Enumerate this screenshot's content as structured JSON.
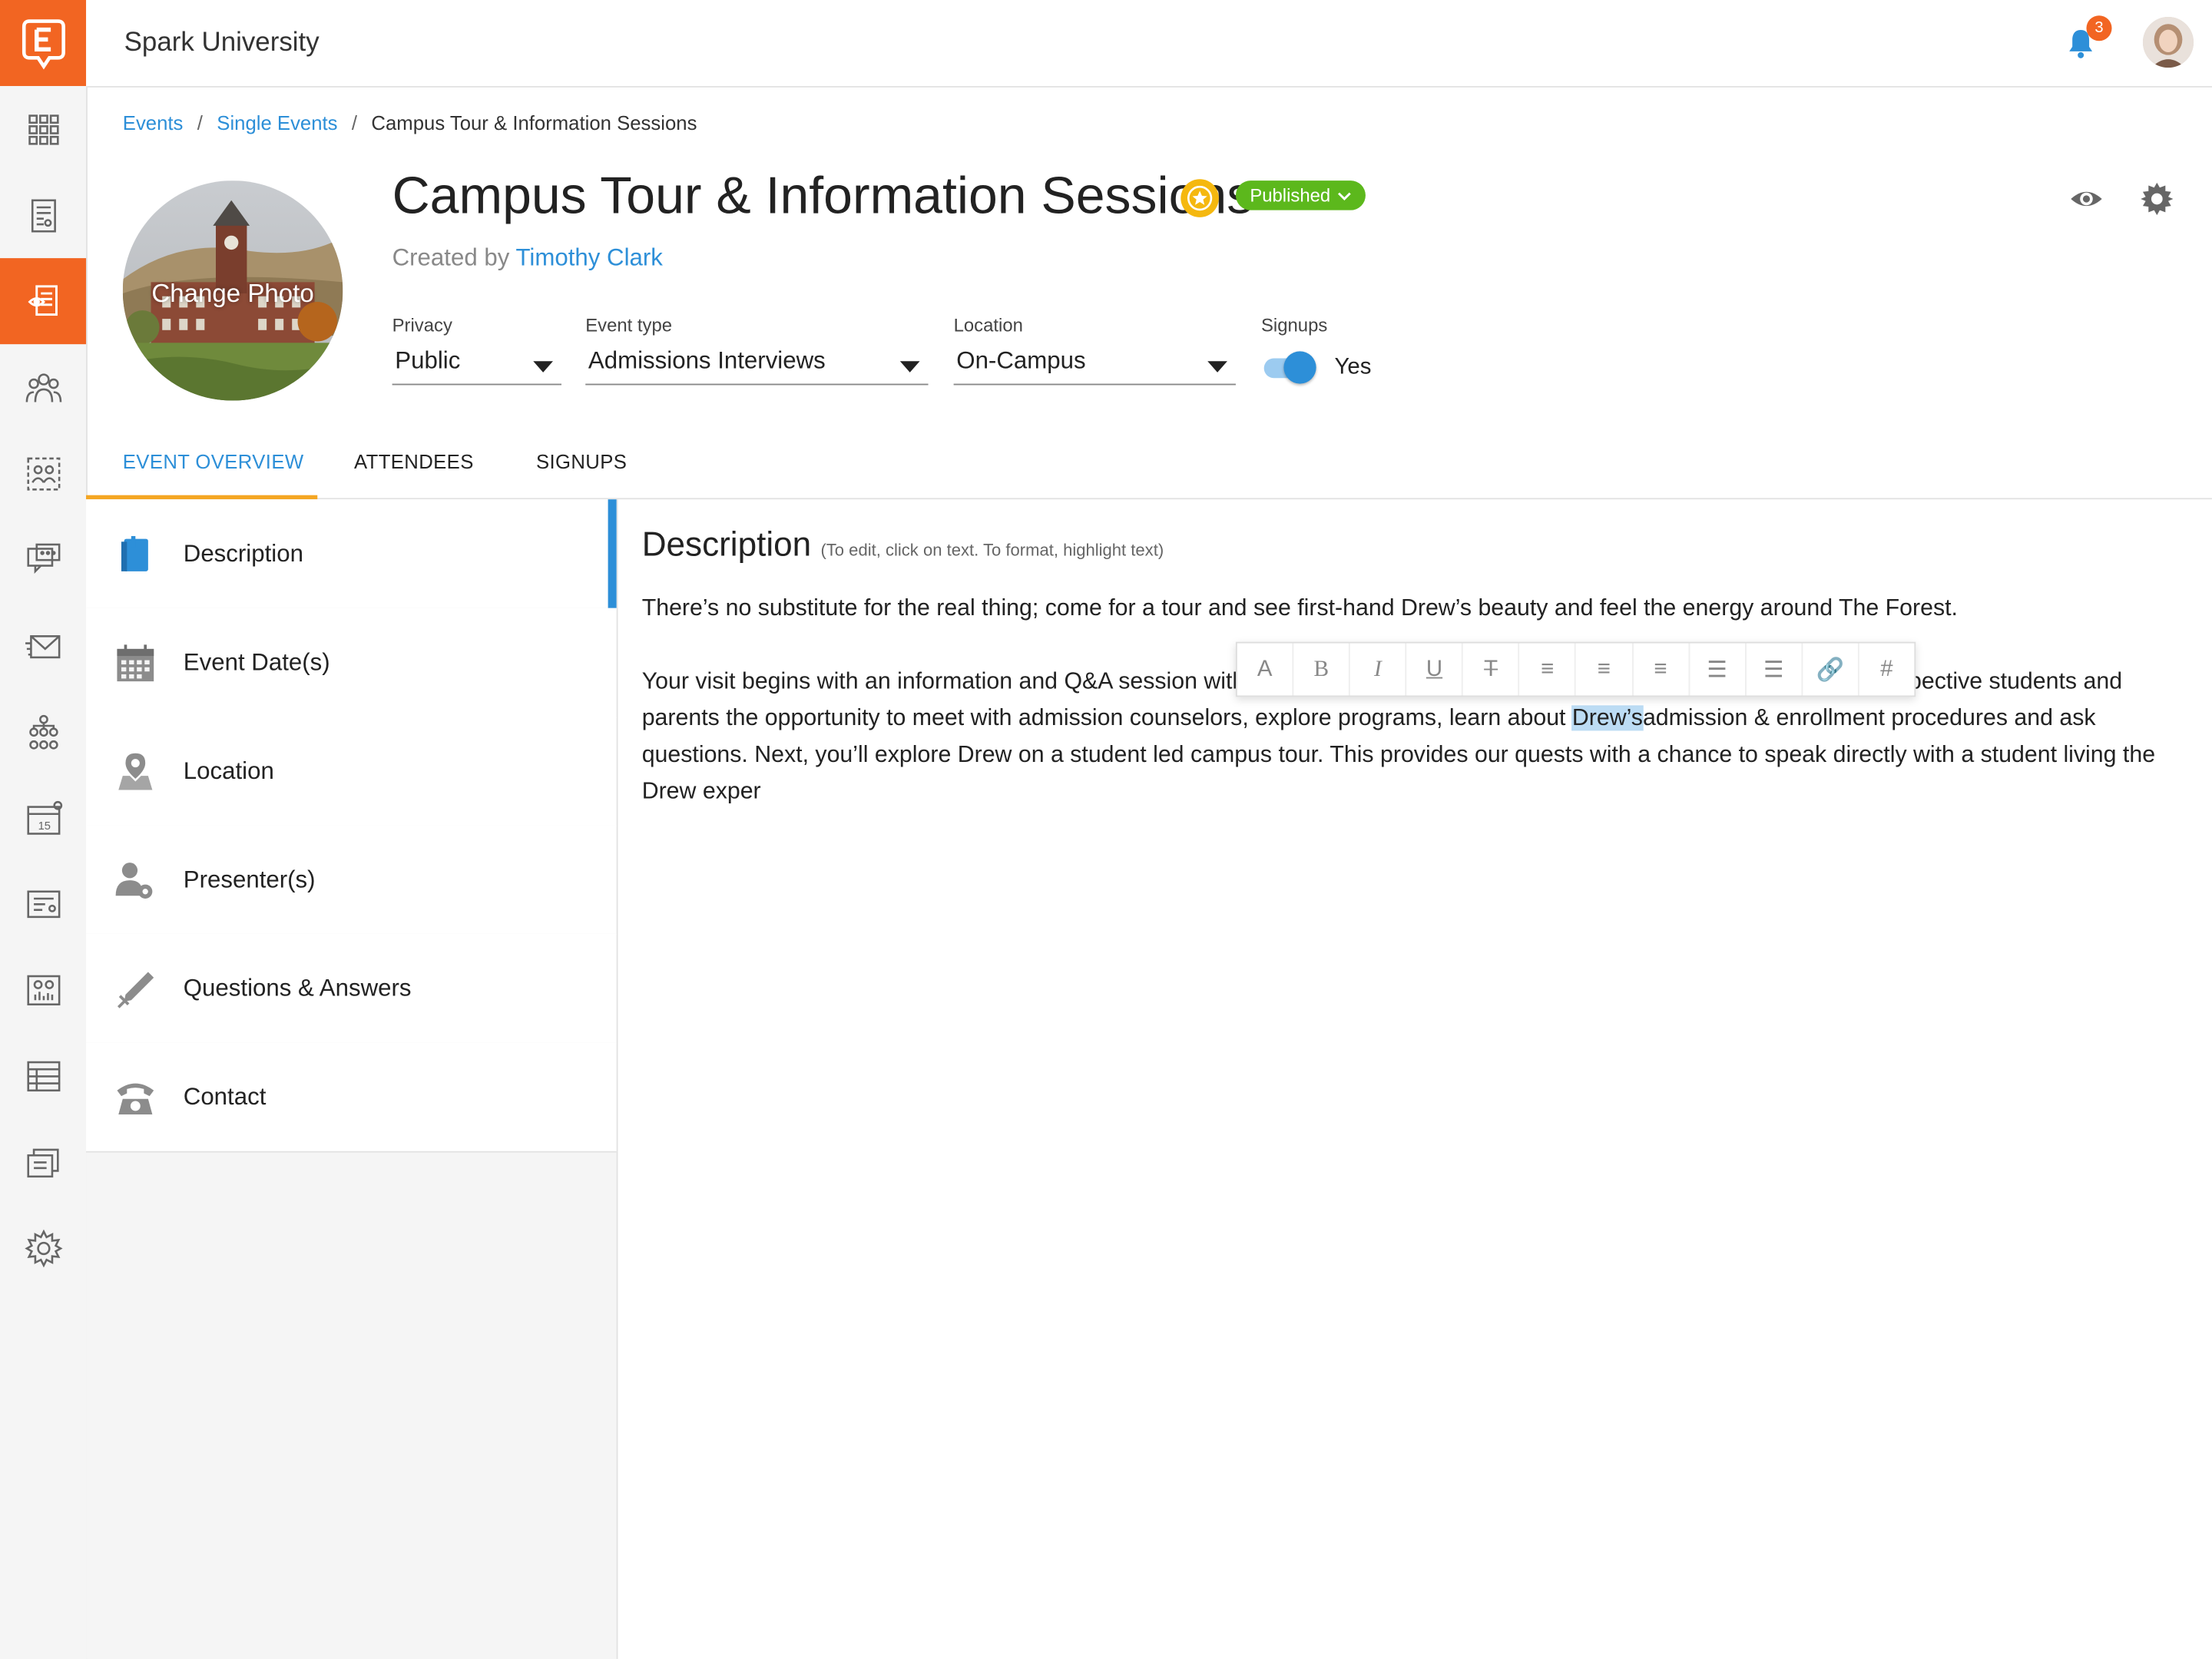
{
  "topbar": {
    "org_name": "Spark University",
    "notification_count": "3"
  },
  "breadcrumb": {
    "items": [
      "Events",
      "Single Events",
      "Campus Tour & Information Sessions"
    ],
    "separator": "/"
  },
  "event": {
    "title": "Campus Tour & Information Sessions",
    "status": "Published",
    "created_by_prefix": "Created by",
    "created_by_name": "Timothy Clark",
    "photo_label": "Change Photo"
  },
  "fields": {
    "privacy": {
      "label": "Privacy",
      "value": "Public"
    },
    "event_type": {
      "label": "Event type",
      "value": "Admissions Interviews"
    },
    "location": {
      "label": "Location",
      "value": "On-Campus"
    },
    "signups": {
      "label": "Signups",
      "value": "Yes",
      "enabled": true
    }
  },
  "tabs": [
    {
      "label": "EVENT OVERVIEW",
      "active": true
    },
    {
      "label": "ATTENDEES",
      "active": false
    },
    {
      "label": "SIGNUPS",
      "active": false
    }
  ],
  "sidebar_sections": [
    {
      "label": "Description",
      "icon": "book-icon",
      "active": true
    },
    {
      "label": "Event Date(s)",
      "icon": "calendar-icon",
      "active": false
    },
    {
      "label": "Location",
      "icon": "location-pin-icon",
      "active": false
    },
    {
      "label": "Presenter(s)",
      "icon": "user-gear-icon",
      "active": false
    },
    {
      "label": "Questions & Answers",
      "icon": "pen-icon",
      "active": false
    },
    {
      "label": "Contact",
      "icon": "telephone-icon",
      "active": false
    }
  ],
  "content": {
    "heading": "Description",
    "hint": "(To edit, click on text. To format, highlight text)",
    "paragraph1": "There’s no substitute for the real thing; come for a tour and see first-hand Drew’s beauty and feel the energy around The Forest.",
    "paragraph2_line1_left": "Your visit begins with an information and Q&A session with",
    "paragraph2_line1_right": "pective students and",
    "paragraph2_line2_before": "parents the opportunity to meet with admission counselors, explore programs, learn about ",
    "paragraph2_highlight": "Drew’s",
    "paragraph2_line2_after": "admission & enrollment procedures and ask",
    "paragraph2_rest": "questions. Next, you’ll explore Drew on a student led campus tour. This provides our quests with a chance to speak directly with a student living the Drew exper"
  },
  "format_toolbar": [
    {
      "glyph": "A",
      "icon": "font-size-icon"
    },
    {
      "glyph": "B",
      "icon": "bold-icon"
    },
    {
      "glyph": "I",
      "icon": "italic-icon"
    },
    {
      "glyph": "U",
      "icon": "underline-icon"
    },
    {
      "glyph": "T",
      "icon": "clear-format-icon"
    },
    {
      "glyph": "≡",
      "icon": "align-left-icon"
    },
    {
      "glyph": "≡",
      "icon": "align-center-icon"
    },
    {
      "glyph": "≡",
      "icon": "align-right-icon"
    },
    {
      "glyph": "☰",
      "icon": "bullet-list-icon"
    },
    {
      "glyph": "☰",
      "icon": "numbered-list-icon"
    },
    {
      "glyph": "🔗",
      "icon": "link-icon"
    },
    {
      "glyph": "#",
      "icon": "hashtag-icon"
    }
  ],
  "rail": {
    "icons": [
      "dashboard-grid-icon",
      "document-list-icon",
      "events-icon",
      "people-group-icon",
      "contacts-icon",
      "chat-icon",
      "mail-icon",
      "org-chart-icon",
      "calendar-icon",
      "form-icon",
      "analytics-icon",
      "table-icon",
      "pages-icon",
      "settings-icon"
    ],
    "active_index": 2
  },
  "colors": {
    "brand": "#f26522",
    "accent": "#2d8fd8",
    "published": "#5cb81c",
    "tab_underline": "#f5a623"
  }
}
